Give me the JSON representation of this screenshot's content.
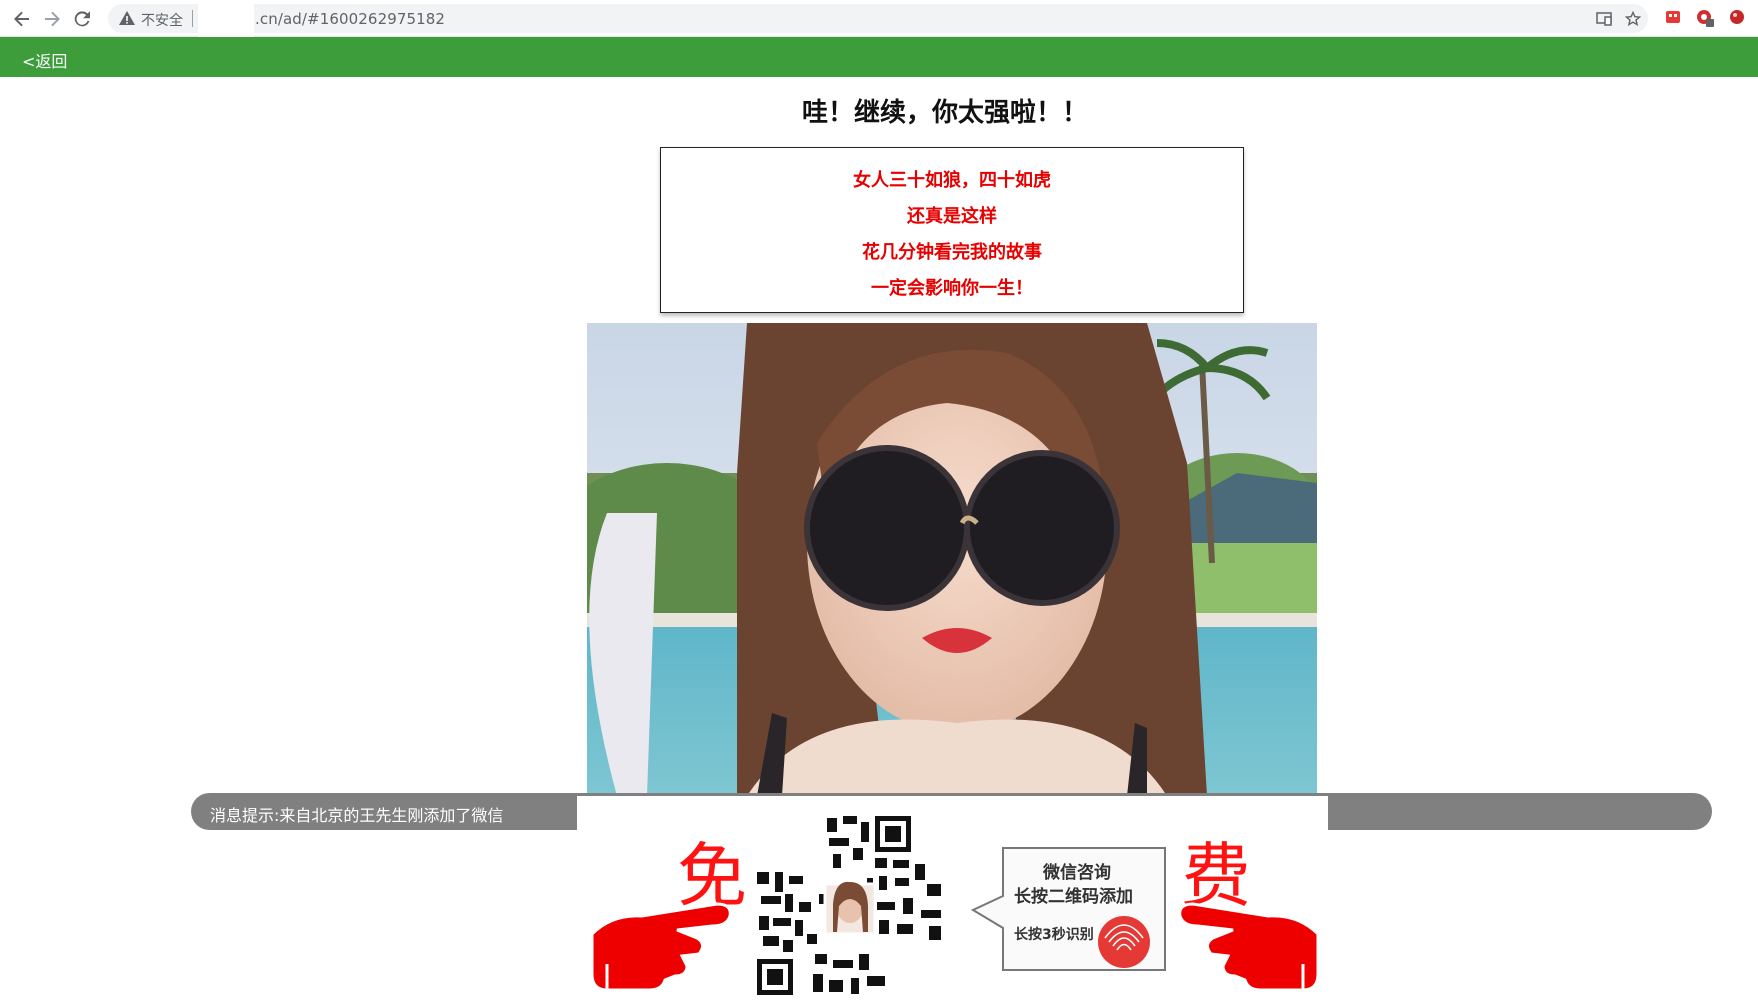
{
  "browser": {
    "back_icon": "arrow-left-icon",
    "forward_icon": "arrow-right-icon",
    "reload_icon": "reload-icon",
    "security_label": "不安全",
    "url": ".cn/ad/#1600262975182",
    "cast_icon": "cast-icon",
    "bookmark_icon": "star-icon"
  },
  "header": {
    "back_label": "<返回",
    "bar_color": "#3c9d3a"
  },
  "headline": "哇！继续，你太强啦！！",
  "story": {
    "lines": [
      "女人三十如狼，四十如虎",
      "还真是这样",
      "花几分钟看完我的故事",
      "一定会影响你一生！"
    ],
    "color": "#e60000"
  },
  "notice": {
    "text": "消息提示:来自北京的王先生刚添加了微信"
  },
  "promo": {
    "left_char": "免",
    "right_char": "费",
    "bubble_line1": "微信咨询",
    "bubble_line2": "长按二维码添加",
    "bubble_line3": "长按3秒识别",
    "accent": "#ff1212"
  }
}
